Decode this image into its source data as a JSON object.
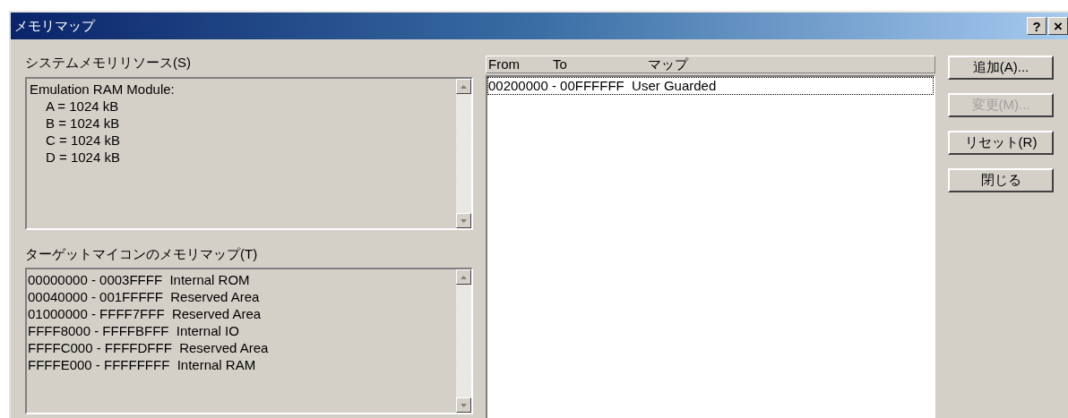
{
  "window": {
    "title": "メモリマップ",
    "help_button": "?",
    "close_button": "×"
  },
  "system_memory": {
    "label": "システムメモリリソース(S)",
    "lines": [
      {
        "text": "Emulation RAM Module:",
        "indented": false
      },
      {
        "text": "A = 1024 kB",
        "indented": true
      },
      {
        "text": "B = 1024 kB",
        "indented": true
      },
      {
        "text": "C = 1024 kB",
        "indented": true
      },
      {
        "text": "D = 1024 kB",
        "indented": true
      }
    ]
  },
  "target_map": {
    "label": "ターゲットマイコンのメモリマップ(T)",
    "lines": [
      "00000000 - 0003FFFF  Internal ROM",
      "00040000 - 001FFFFF  Reserved Area",
      "01000000 - FFFF7FFF  Reserved Area",
      "FFFF8000 - FFFFBFFF  Internal IO",
      "FFFFC000 - FFFFDFFF  Reserved Area",
      "FFFFE000 - FFFFFFFF  Internal RAM"
    ]
  },
  "map_list": {
    "columns": [
      "From",
      "To",
      "マップ"
    ],
    "rows": [
      {
        "text": "00200000 - 00FFFFFF  User Guarded",
        "selected": true
      }
    ]
  },
  "buttons": [
    {
      "label": "追加(A)...",
      "disabled": false
    },
    {
      "label": "変更(M)...",
      "disabled": true
    },
    {
      "label": "リセット(R)",
      "disabled": false
    },
    {
      "label": "閉じる",
      "disabled": false
    }
  ]
}
